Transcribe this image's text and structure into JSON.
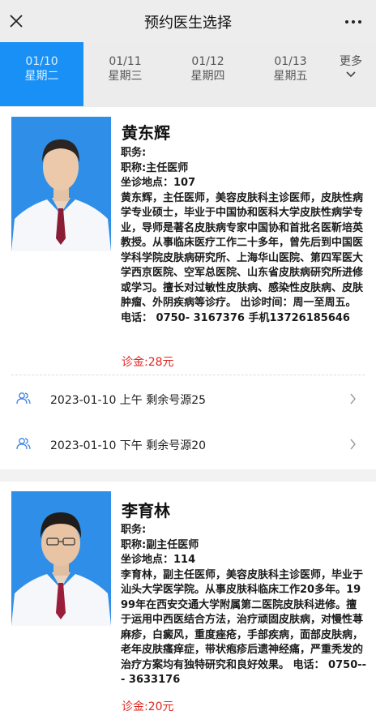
{
  "header": {
    "title": "预约医生选择",
    "close_icon": "close-icon",
    "more_icon": "more-dots-icon"
  },
  "date_tabs": [
    {
      "date": "01/10",
      "weekday": "星期二",
      "active": true
    },
    {
      "date": "01/11",
      "weekday": "星期三",
      "active": false
    },
    {
      "date": "01/12",
      "weekday": "星期四",
      "active": false
    },
    {
      "date": "01/13",
      "weekday": "星期五",
      "active": false
    }
  ],
  "more_dates": {
    "label": "更多",
    "icon": "chevron-down-icon"
  },
  "colors": {
    "accent": "#1890f5",
    "fee": "#e0241f",
    "slot_icon": "#3b82e6"
  },
  "doctors": [
    {
      "name": "黄东辉",
      "duty": "职务:",
      "title": "职称:主任医师",
      "location": "坐诊地点：107",
      "bio": "黄东辉，主任医师，美容皮肤科主诊医师，皮肤性病学专业硕士，毕业于中国协和医科大学皮肤性病学专业，导师是著名皮肤病专家中国协和首批名医靳培英教授。从事临床医疗工作二十多年，曾先后到中国医学科学院皮肤病研究所、上海华山医院、第四军医大学西京医院、空军总医院、山东省皮肤病研究所进修或学习。擅长对过敏性皮肤病、感染性皮肤病、皮肤肿瘤、外阴疾病等诊疗。 出诊时间：周一至周五。 电话： 0750- 3167376 手机13726185646",
      "fee": "诊金:28元",
      "slots": [
        {
          "text": "2023-01-10 上午 剩余号源25",
          "icon": "people-icon"
        },
        {
          "text": "2023-01-10 下午 剩余号源20",
          "icon": "people-icon"
        }
      ]
    },
    {
      "name": "李育林",
      "duty": "职务:",
      "title": "职称:副主任医师",
      "location": "坐诊地点：114",
      "bio": "李育林，副主任医师，美容皮肤科主诊医师，毕业于汕头大学医学院。从事皮肤科临床工作20多年。1999年在西安交通大学附属第二医院皮肤科进修。擅于运用中西医结合方法，治疗顽固皮肤病，对慢性荨麻疹，白癜风，重度痤疮，手部疾病，面部皮肤病，老年皮肤瘙痒症，带状疱疹后遗神经痛，严重秃发的治疗方案均有独特研究和良好效果。 电话： 0750--- 3633176",
      "fee": "诊金:20元"
    }
  ]
}
